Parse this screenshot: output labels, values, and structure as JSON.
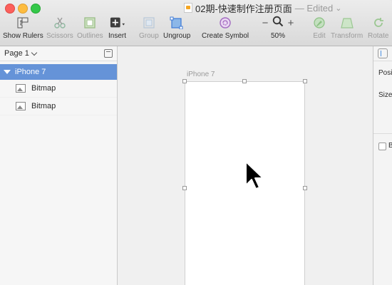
{
  "window": {
    "title": "02期-快速制作注册页面",
    "status": "— Edited",
    "status_chevron": "⌄"
  },
  "toolbar": {
    "show_rulers": "Show Rulers",
    "scissors": "Scissors",
    "outlines": "Outlines",
    "insert": "Insert",
    "group": "Group",
    "ungroup": "Ungroup",
    "create_symbol": "Create Symbol",
    "zoom_minus": "−",
    "zoom_plus": "+",
    "zoom_level": "50%",
    "edit": "Edit",
    "transform": "Transform",
    "rotate": "Rotate"
  },
  "sidebar": {
    "page": "Page 1",
    "artboard_layer": "iPhone 7",
    "layers": [
      "Bitmap",
      "Bitmap"
    ]
  },
  "canvas": {
    "artboard_label": "iPhone 7"
  },
  "inspector": {
    "position_label": "Posi",
    "size_label": "Size",
    "checkbox_label": "B"
  },
  "colors": {
    "selection": "#6593d8",
    "accent": "#4a90e2"
  }
}
